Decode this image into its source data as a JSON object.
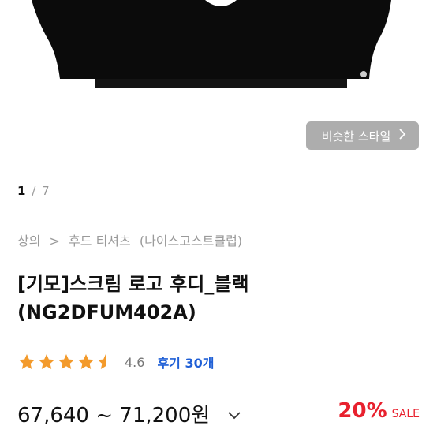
{
  "product_image": {
    "alt": "black hoodie"
  },
  "similar_button": {
    "label": "비슷한 스타일"
  },
  "pager": {
    "current": "1",
    "separator": "/",
    "total": "7"
  },
  "breadcrumb": [
    "상의",
    ">",
    "후드 티셔츠",
    "(나이스고스트클럽)"
  ],
  "product": {
    "title_line1": "[기모]스크림 로고 후디_블랙",
    "title_line2": "(NG2DFUM402A)"
  },
  "rating": {
    "stars": 4.5,
    "score": "4.6",
    "review_label": "후기 30개",
    "star_color": "#f39a2b"
  },
  "price": {
    "range": "67,640 ~ 71,200원",
    "discount": "20%",
    "sale_label": "SALE",
    "accent": "#e8212e"
  }
}
